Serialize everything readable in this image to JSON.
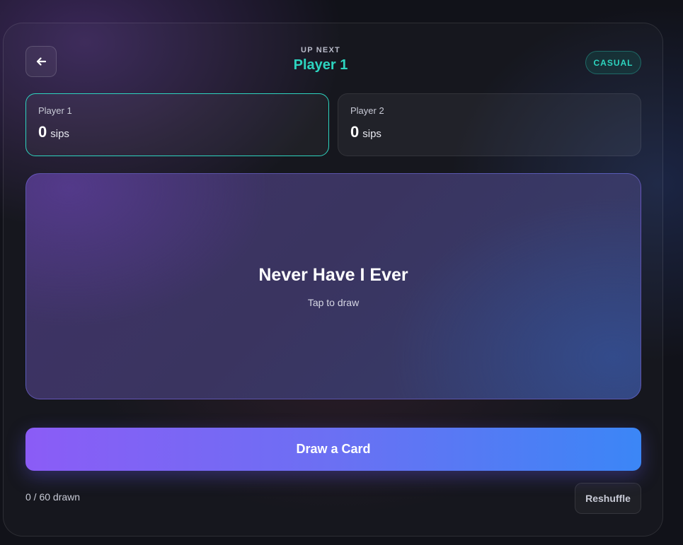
{
  "header": {
    "back_icon": "arrow-left-icon",
    "up_next_label": "UP NEXT",
    "up_next_player": "Player 1",
    "mode_badge": "CASUAL"
  },
  "players": [
    {
      "name": "Player 1",
      "score": "0",
      "unit": "sips",
      "active": true
    },
    {
      "name": "Player 2",
      "score": "0",
      "unit": "sips",
      "active": false
    }
  ],
  "deck": {
    "title": "Never Have I Ever",
    "hint": "Tap to draw"
  },
  "actions": {
    "draw_label": "Draw a Card",
    "drawn_count": "0 / 60 drawn",
    "reshuffle_label": "Reshuffle"
  },
  "colors": {
    "accent_teal": "#2dd4bf",
    "button_gradient_start": "#8b5cf6",
    "button_gradient_end": "#3b86f6",
    "background": "#111219"
  }
}
